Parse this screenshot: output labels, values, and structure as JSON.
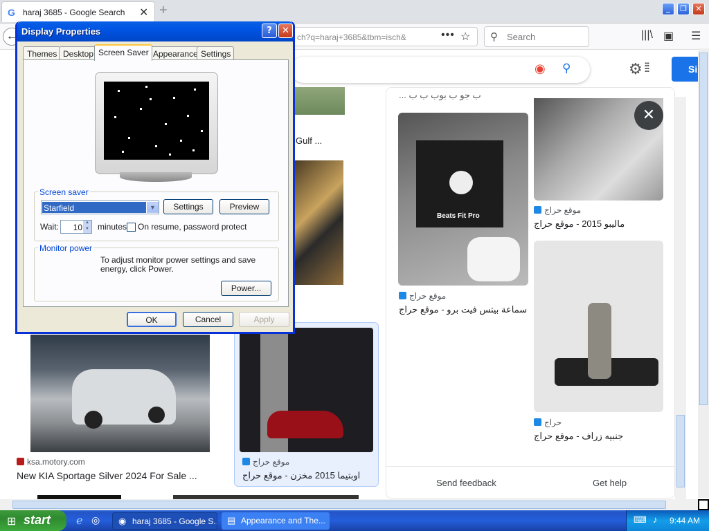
{
  "browser": {
    "tab_title": "haraj 3685 - Google Search",
    "tab_favicon": "G",
    "new_tab": "+",
    "url": "ch?q=haraj+3685&tbm=isch&",
    "search_placeholder": "Search",
    "window_buttons": [
      "_",
      "❐",
      "✕"
    ]
  },
  "google": {
    "signin_label": "Si"
  },
  "results": {
    "left_caption_gulf": "Gulf ...",
    "kia_source": "ksa.motory.com",
    "kia_caption": "New KIA Sportage Silver 2024 For Sale ...",
    "optima_source": "موقع حراج",
    "optima_caption": "اوبتيما 2015 مخزن - موقع حراج"
  },
  "panel": {
    "top_partial_text": "... ب جو ب بوب ب ب",
    "beats_source": "موقع حراج",
    "beats_caption": "سماعة بيتس فيت برو - موقع حراج",
    "beats_box_text": "Beats Fit Pro",
    "malibu_source": "موقع حراج",
    "malibu_caption": "ماليبو 2015 - موقع حراج",
    "janbiya_source": "حراج",
    "janbiya_caption": "جنبيه زراف - موقع حراج",
    "send_feedback": "Send feedback",
    "get_help": "Get help",
    "close": "✕"
  },
  "dialog": {
    "title": "Display Properties",
    "help": "?",
    "close": "✕",
    "tabs": [
      "Themes",
      "Desktop",
      "Screen Saver",
      "Appearance",
      "Settings"
    ],
    "screensaver_group": "Screen saver",
    "screensaver_value": "Starfield",
    "settings_btn": "Settings",
    "preview_btn": "Preview",
    "wait_label": "Wait:",
    "wait_value": "10",
    "minutes_label": "minutes",
    "password_label": "On resume, password protect",
    "monitor_group": "Monitor power",
    "monitor_text": "To adjust monitor power settings and save energy, click Power.",
    "power_btn": "Power...",
    "ok_btn": "OK",
    "cancel_btn": "Cancel",
    "apply_btn": "Apply"
  },
  "taskbar": {
    "start": "start",
    "task1": "haraj 3685 - Google S...",
    "task2": "Appearance and The...",
    "clock": "9:44 AM"
  }
}
